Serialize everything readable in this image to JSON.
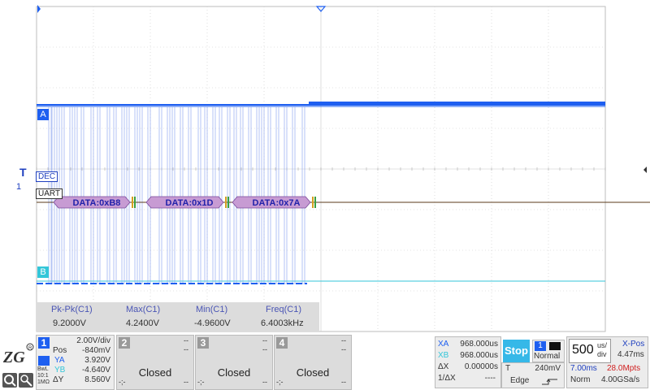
{
  "colors": {
    "ch_a": "#1e5ff0",
    "ch_b": "#33c6d9",
    "grid": "#c8c8c8",
    "decode_fill": "#c79bd3",
    "decode_text": "#2222aa",
    "run_stop": "#36b8e8",
    "accent_red": "#d02020"
  },
  "markers": {
    "ch_a": "A",
    "ch_b": "B",
    "trigger_t": "T",
    "ch1_marker": "1"
  },
  "decode": {
    "dec_label": "DEC",
    "uart_label": "UART",
    "packets": [
      "DATA:0xB8",
      "DATA:0x1D",
      "DATA:0x7A"
    ]
  },
  "measurements": [
    {
      "label": "Pk-Pk(C1)",
      "value": "9.2000V"
    },
    {
      "label": "Max(C1)",
      "value": "4.2400V"
    },
    {
      "label": "Min(C1)",
      "value": "-4.9600V"
    },
    {
      "label": "Freq(C1)",
      "value": "6.4003kHz"
    }
  ],
  "channel1": {
    "num": "1",
    "scale": "2.00V/div",
    "pos_label": "Pos",
    "pos": "-840mV",
    "ya_label": "YA",
    "ya": "3.920V",
    "yb_label": "YB",
    "yb": "-4.640V",
    "dy_label": "ΔY",
    "dy": "8.560V",
    "bw": "BwL",
    "probe": "10:1",
    "imp": "1MΩ"
  },
  "channels": [
    {
      "num": "2",
      "status": "Closed",
      "d1": "--",
      "d2": "--",
      "d3": "--",
      "d4": "--",
      "d5": "-;-"
    },
    {
      "num": "3",
      "status": "Closed",
      "d1": "--",
      "d2": "--",
      "d3": "--",
      "d4": "--",
      "d5": "-;-"
    },
    {
      "num": "4",
      "status": "Closed",
      "d1": "--",
      "d2": "--",
      "d3": "--",
      "d4": "--",
      "d5": "-;-"
    }
  ],
  "cursors": {
    "xa_label": "XA",
    "xa": "968.000us",
    "xb_label": "XB",
    "xb": "968.000us",
    "dx_label": "ΔX",
    "dx": "0.00000s",
    "inv_label": "1/ΔX",
    "inv": "----"
  },
  "run": {
    "state": "Stop"
  },
  "trigger": {
    "source": "1",
    "mode": "Normal",
    "type_label": "T",
    "level": "240mV",
    "kind": "Edge"
  },
  "timebase": {
    "value": "500",
    "unit_top": "us/",
    "unit_bottom": "div",
    "xpos_label": "X-Pos",
    "xpos": "4.47ms",
    "window": "7.00ms",
    "memory": "28.0Mpts",
    "acq_mode": "Norm",
    "sample_rate": "4.00GSa/s"
  }
}
